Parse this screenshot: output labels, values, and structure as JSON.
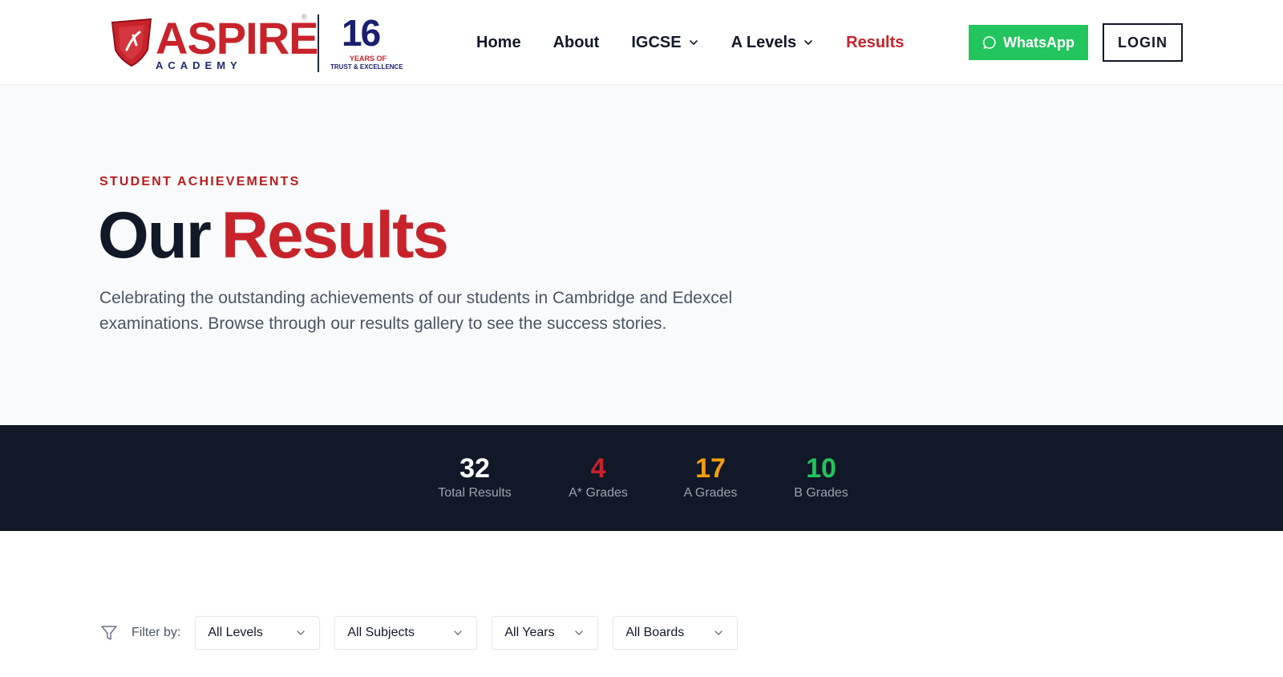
{
  "header": {
    "logo": {
      "brand": "ASPIRE",
      "registered": "®",
      "sub": "ACADEMY",
      "years_number": "16",
      "years_line1": "YEARS OF",
      "years_line2": "TRUST & EXCELLENCE"
    },
    "nav": [
      {
        "label": "Home",
        "dropdown": false,
        "active": false
      },
      {
        "label": "About",
        "dropdown": false,
        "active": false
      },
      {
        "label": "IGCSE",
        "dropdown": true,
        "active": false
      },
      {
        "label": "A Levels",
        "dropdown": true,
        "active": false
      },
      {
        "label": "Results",
        "dropdown": false,
        "active": true
      }
    ],
    "whatsapp_label": "WhatsApp",
    "login_label": "LOGIN"
  },
  "hero": {
    "eyebrow": "STUDENT ACHIEVEMENTS",
    "title_part1": "Our",
    "title_part2": "Results",
    "description": "Celebrating the outstanding achievements of our students in Cambridge and Edexcel examinations. Browse through our results gallery to see the success stories."
  },
  "stats": [
    {
      "value": "32",
      "label": "Total Results",
      "color": "#ffffff"
    },
    {
      "value": "4",
      "label": "A* Grades",
      "color": "#c8232b"
    },
    {
      "value": "17",
      "label": "A Grades",
      "color": "#f59e0b"
    },
    {
      "value": "10",
      "label": "B Grades",
      "color": "#22c55e"
    }
  ],
  "filters": {
    "label": "Filter by:",
    "selects": [
      {
        "value": "All Levels"
      },
      {
        "value": "All Subjects"
      },
      {
        "value": "All Years"
      },
      {
        "value": "All Boards"
      }
    ]
  },
  "colors": {
    "brand_red": "#c8232b",
    "navy": "#111827",
    "whatsapp_green": "#22c55e",
    "amber": "#f59e0b"
  }
}
